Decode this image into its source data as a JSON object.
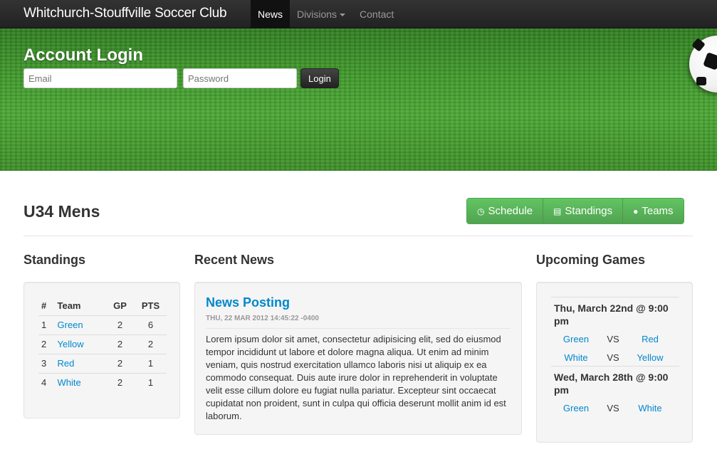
{
  "navbar": {
    "brand": "Whitchurch-Stouffville Soccer Club",
    "items": [
      {
        "label": "News",
        "active": true
      },
      {
        "label": "Divisions",
        "dropdown": true
      },
      {
        "label": "Contact"
      }
    ]
  },
  "hero": {
    "title": "Account Login",
    "email_placeholder": "Email",
    "password_placeholder": "Password",
    "login_label": "Login"
  },
  "page": {
    "title": "U34 Mens",
    "buttons": [
      {
        "label": "Schedule",
        "icon": "clock-icon"
      },
      {
        "label": "Standings",
        "icon": "list-icon"
      },
      {
        "label": "Teams",
        "icon": "user-icon"
      }
    ]
  },
  "standings": {
    "title": "Standings",
    "headers": [
      "#",
      "Team",
      "GP",
      "PTS"
    ],
    "rows": [
      {
        "rank": "1",
        "team": "Green",
        "gp": "2",
        "pts": "6"
      },
      {
        "rank": "2",
        "team": "Yellow",
        "gp": "2",
        "pts": "2"
      },
      {
        "rank": "3",
        "team": "Red",
        "gp": "2",
        "pts": "1"
      },
      {
        "rank": "4",
        "team": "White",
        "gp": "2",
        "pts": "1"
      }
    ]
  },
  "news": {
    "title": "Recent News",
    "post_title": "News Posting",
    "post_date": "THU, 22 MAR 2012 14:45:22 -0400",
    "post_body": "Lorem ipsum dolor sit amet, consectetur adipisicing elit, sed do eiusmod tempor incididunt ut labore et dolore magna aliqua. Ut enim ad minim veniam, quis nostrud exercitation ullamco laboris nisi ut aliquip ex ea commodo consequat. Duis aute irure dolor in reprehenderit in voluptate velit esse cillum dolore eu fugiat nulla pariatur. Excepteur sint occaecat cupidatat non proident, sunt in culpa qui officia deserunt mollit anim id est laborum."
  },
  "games": {
    "title": "Upcoming Games",
    "vs_label": "VS",
    "list": [
      {
        "date": "Thu, March 22nd @ 9:00 pm",
        "matches": [
          {
            "home": "Green",
            "away": "Red"
          },
          {
            "home": "White",
            "away": "Yellow"
          }
        ]
      },
      {
        "date": "Wed, March 28th @ 9:00 pm",
        "matches": [
          {
            "home": "Green",
            "away": "White"
          }
        ]
      }
    ]
  },
  "colors": {
    "navbar_bg": "#222222",
    "link": "#0088cc",
    "button_green": "#5bb75b"
  }
}
